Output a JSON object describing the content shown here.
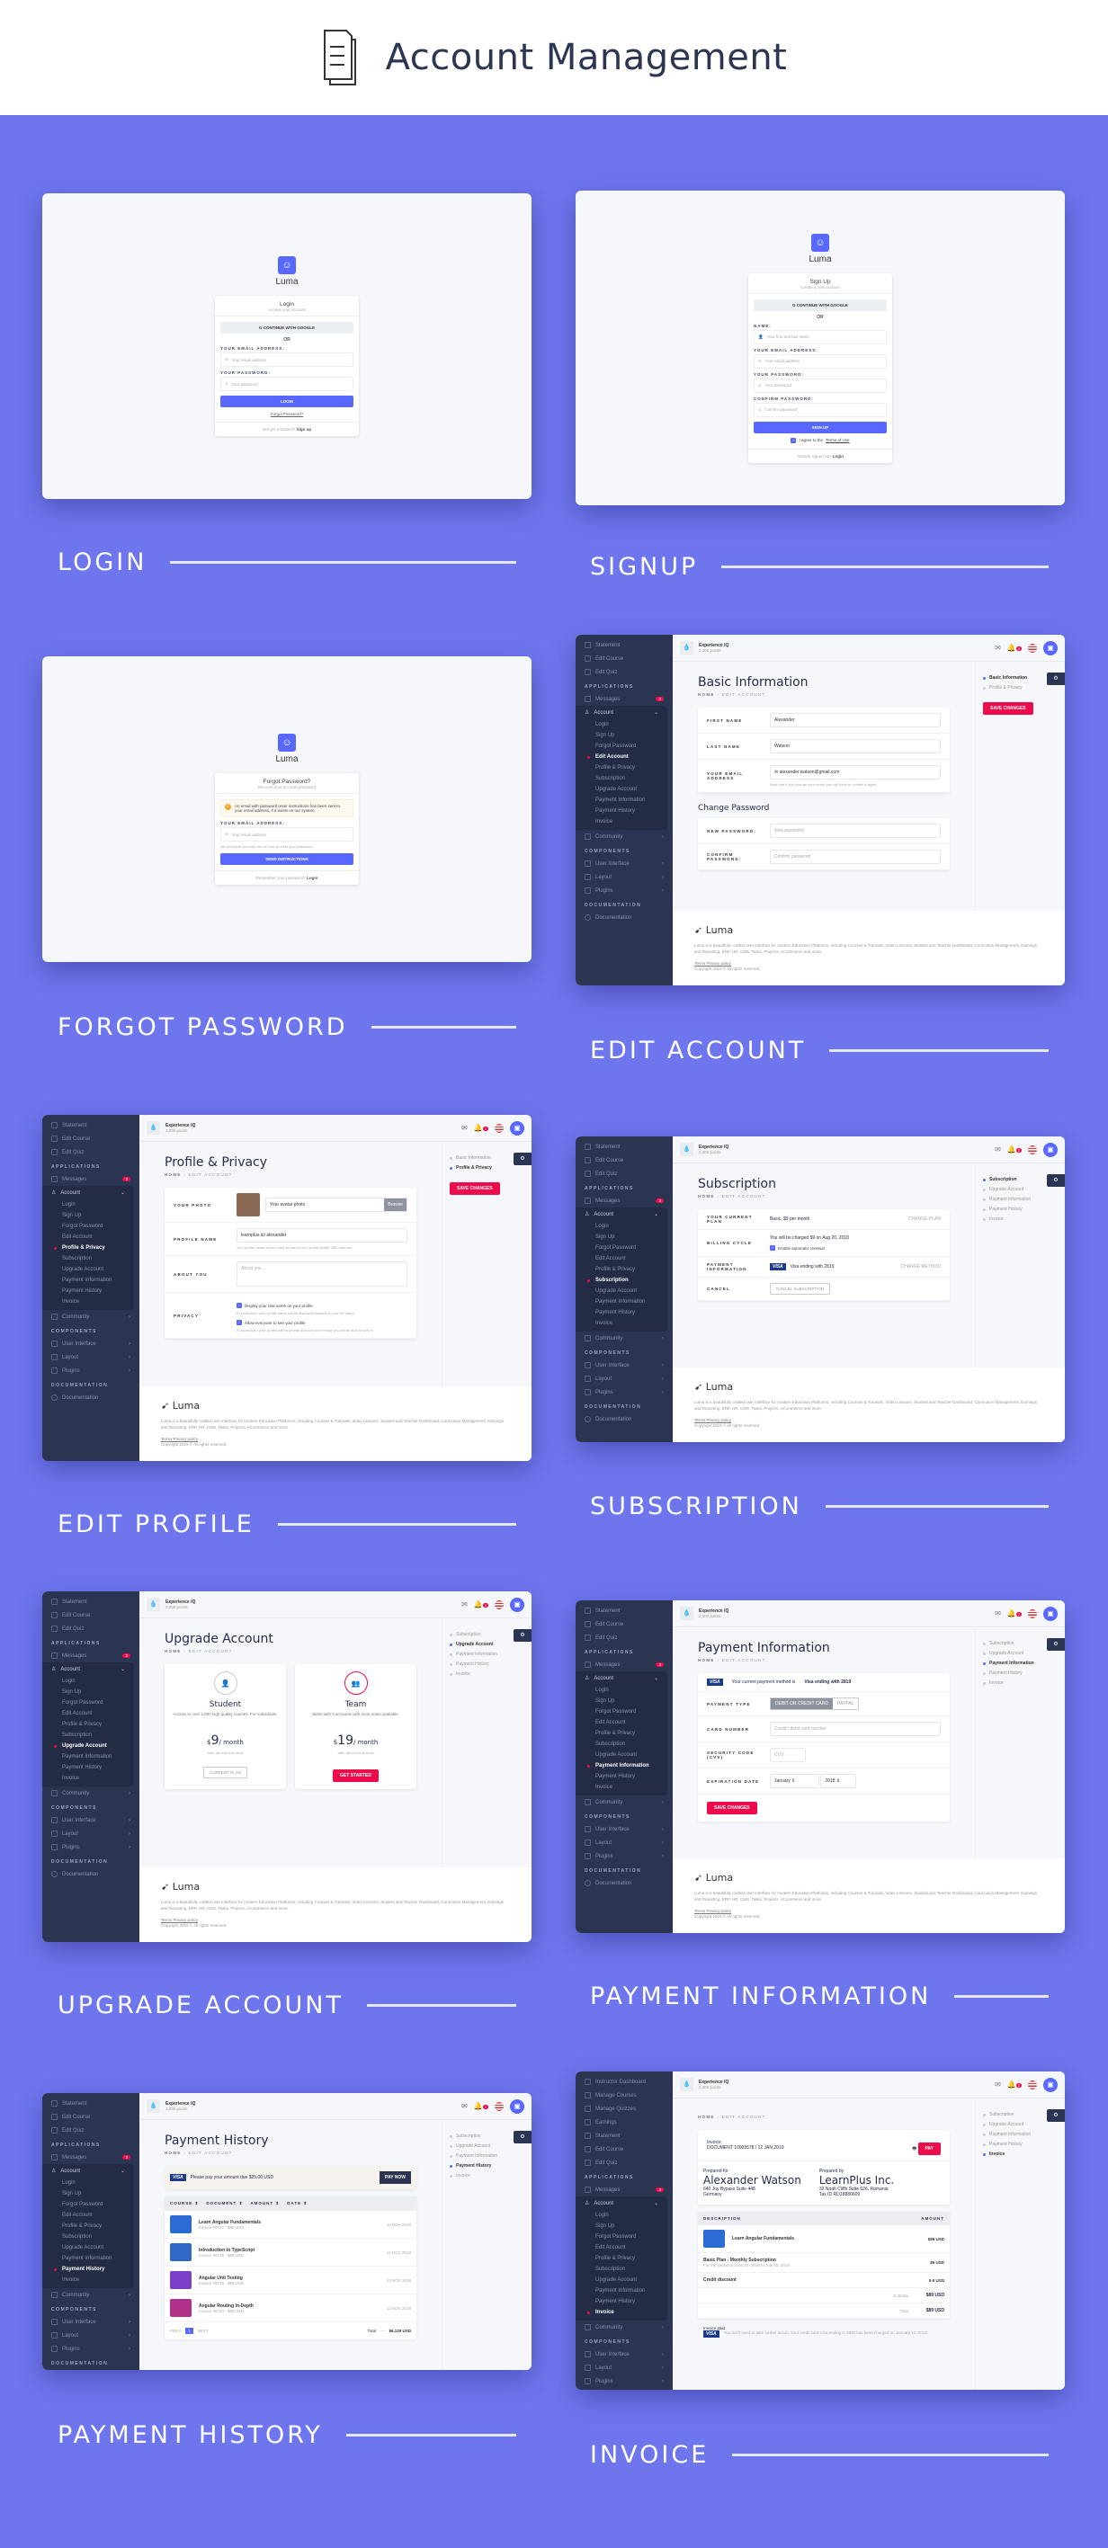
{
  "header": {
    "title": "Account Management",
    "icon": "document-icon"
  },
  "captions": [
    "LOGIN",
    "SIGNUP",
    "FORGOT PASSWORD",
    "EDIT ACCOUNT",
    "EDIT PROFILE",
    "SUBSCRIPTION",
    "UPGRADE ACCOUNT",
    "PAYMENT INFORMATION",
    "PAYMENT HISTORY",
    "INVOICE"
  ],
  "brand": "Luma",
  "login": {
    "title": "Login",
    "subtitle": "Access your account",
    "google": "CONTINUE WITH GOOGLE",
    "or": "OR",
    "email_label": "YOUR EMAIL ADDRESS:",
    "email_ph": "Your email address",
    "pass_label": "YOUR PASSWORD:",
    "pass_ph": "Your password",
    "submit": "LOGIN",
    "forgot": "Forgot Password?",
    "footer_text": "Not yet a student?",
    "footer_link": "Sign up"
  },
  "signup": {
    "title": "Sign Up",
    "subtitle": "Create a new account",
    "google": "CONTINUE WITH GOOGLE",
    "or": "OR",
    "name_label": "NAME:",
    "name_ph": "Your first and last name",
    "email_label": "YOUR EMAIL ADDRESS:",
    "email_ph": "Your email address",
    "pass_label": "YOUR PASSWORD:",
    "pass_ph": "Your password",
    "confirm_label": "CONFIRM PASSWORD:",
    "confirm_ph": "Confirm password",
    "submit": "SIGN UP",
    "agree": "I agree to the",
    "terms": "Terms of Use",
    "footer_text": "Already signed up?",
    "footer_link": "Login"
  },
  "forgot": {
    "title": "Forgot Password?",
    "subtitle": "Recover your account password",
    "alert": "An email with password reset instructions has been sent to your email address, if it exists on our system.",
    "email_label": "YOUR EMAIL ADDRESS:",
    "email_ph": "Your email address",
    "hint": "We will email you with info on how to reset your password.",
    "submit": "SEND INSTRUCTIONS",
    "footer_text": "Remember your password?",
    "footer_link": "Login"
  },
  "app": {
    "xp_title": "Experience IQ",
    "xp_points": "2,300 points",
    "notif_count": "2",
    "sidebar_top": [
      "Statement",
      "Edit Course",
      "Edit Quiz"
    ],
    "sidebar_top_invoice": [
      "Instructor Dashboard",
      "Manage Courses",
      "Manage Quizzes",
      "Earnings",
      "Statement",
      "Edit Course",
      "Edit Quiz"
    ],
    "applications": "APPLICATIONS",
    "messages": "Messages",
    "messages_badge": "3",
    "account": "Account",
    "account_items": [
      "Login",
      "Sign Up",
      "Forgot Password",
      "Edit Account",
      "Profile & Privacy",
      "Subscription",
      "Upgrade Account",
      "Payment Information",
      "Payment History",
      "Invoice"
    ],
    "community": "Community",
    "components": "COMPONENTS",
    "components_items": [
      "User Interface",
      "Layout",
      "Plugins"
    ],
    "documentation": "DOCUMENTATION",
    "doc_item": "Documentation",
    "breadcrumb_home": "HOME",
    "breadcrumb_current": "EDIT ACCOUNT",
    "save": "SAVE CHANGES",
    "rnav_edit": [
      "Basic Information",
      "Profile & Privacy"
    ],
    "rnav_billing": [
      "Subscription",
      "Upgrade Account",
      "Payment Information",
      "Payment History",
      "Invoice"
    ],
    "footer": {
      "brand": "Luma",
      "text": "Luma is a beautifully crafted user interface for modern Education Platforms, including Courses & Tutorials, Video Lessons, Student and Teacher Dashboard, Curriculum Management, Earnings and Reporting, ERP, HR, CMS, Tasks, Projects, eCommerce and more.",
      "terms": "Terms",
      "privacy": "Privacy policy",
      "copyright": "Copyright 2019 © All rights reserved."
    }
  },
  "edit_account": {
    "title": "Basic Information",
    "first_label": "FIRST NAME",
    "first": "Alexander",
    "last_label": "LAST NAME",
    "last": "Watson",
    "email_label": "YOUR EMAIL ADDRESS",
    "email": "alexander.watson@gmail.com",
    "email_hint": "Note that if you change your email, you will have to confirm it again.",
    "pw_title": "Change Password",
    "new_label": "NEW PASSWORD:",
    "new_ph": "New password",
    "confirm_label": "CONFIRM PASSWORD:",
    "confirm_ph": "Confirm password"
  },
  "profile": {
    "title": "Profile & Privacy",
    "photo_label": "YOUR PHOTO",
    "photo_ph": "Your avatar photo",
    "browse": "Browse",
    "name_label": "PROFILE NAME",
    "name_prefix": "learnplus.io/",
    "name": "alexander",
    "name_hint": "Your profile name will be used as part of your public profile URL address.",
    "about_label": "ABOUT YOU",
    "about_ph": "About you ...",
    "privacy_label": "PRIVACY",
    "opt1": "Display your real name on your profile",
    "opt1_hint": "If unchecked, your profile name will be displayed instead of your full name.",
    "opt2": "Allow everyone to see your profile",
    "opt2_hint": "If unchecked, your profile will be private and one one except you will be able to view it."
  },
  "subscription": {
    "title": "Subscription",
    "plan_label": "YOUR CURRENT PLAN",
    "plan": "Basic, $9 per month",
    "change_plan": "CHANGE PLAN",
    "cycle_label": "BILLING CYCLE",
    "cycle": "You will be charged $9 on Aug 20, 2018",
    "renew": "Enable automatic renewal",
    "pay_label": "PAYMENT INFORMATION",
    "card": "Visa ending with 2819",
    "change_method": "CHANGE METHOD",
    "cancel_label": "CANCEL",
    "cancel_btn": "CANCEL SUBSCRIPTION"
  },
  "upgrade": {
    "title": "Upgrade Account",
    "plans": [
      {
        "name": "Student",
        "desc": "Access to over 1.000 high quality courses. For individuals.",
        "price": "9",
        "per": "/ month",
        "after": "after the free trial ends",
        "btn": "CURRENT PLAN"
      },
      {
        "name": "Team",
        "desc": "Starts with 3 accounts with more seats available.",
        "price": "19",
        "per": "/ month",
        "after": "after the free trial ends",
        "btn": "GET STARTED"
      }
    ]
  },
  "payment_info": {
    "title": "Payment Information",
    "current": "Your current payment method is",
    "current_card": "Visa ending with 2819",
    "type_label": "PAYMENT TYPE",
    "type_card": "DEBIT OR CREDIT CARD",
    "type_paypal": "PAYPAL",
    "card_label": "CARD NUMBER",
    "card_ph": "Credit / debit card number",
    "cvv_label": "SECURITY CODE (CVV)",
    "cvv_ph": "CVV",
    "exp_label": "EXPIRATION DATE",
    "exp_month": "January",
    "exp_year": "2018"
  },
  "payment_history": {
    "title": "Payment History",
    "due": "Please pay your amount due $25.00 USD",
    "pay_now": "PAY NOW",
    "columns": [
      "COURSE",
      "DOCUMENT",
      "AMOUNT",
      "DATE"
    ],
    "rows": [
      {
        "course": "Learn Angular Fundamentals",
        "invoice": "Invoice #8737 - $89 USD",
        "date": "15 NOV 2018",
        "color": "#2b6bd6"
      },
      {
        "course": "Introduction to TypeScript",
        "invoice": "Invoice #8736 - $89 USD",
        "date": "14 NOV 2018",
        "color": "#3167c7"
      },
      {
        "course": "Angular Unit Testing",
        "invoice": "Invoice #8735 - $89 USD",
        "date": "13 NOV 2018",
        "color": "#7a3fc8"
      },
      {
        "course": "Angular Routing In-Depth",
        "invoice": "Invoice #8734 - $89 USD",
        "date": "12 NOV 2018",
        "color": "#b0308a"
      }
    ],
    "prev": "PREV",
    "page": "1",
    "next": "NEXT",
    "total_label": "Total",
    "total": "$6,129 USD"
  },
  "invoice": {
    "title": "Invoice",
    "doc": "DOCUMENT 10003578 / 12 JAN 2019",
    "pay": "PAY",
    "for_label": "Prepared for",
    "for_name": "Alexander Watson",
    "for_addr": "640 Joy Bypass Suite 448",
    "for_country": "Germany",
    "by_label": "Prepared by",
    "by_name": "LearnPlus Inc.",
    "by_addr": "32 Noah Cliffs Suite 626, Romania",
    "by_tax": "Tax ID RO18880609",
    "col_desc": "DESCRIPTION",
    "col_amount": "AMOUNT",
    "items": [
      {
        "desc": "Learn Angular Fundamentals",
        "sub": "",
        "amount": "$89 USD"
      },
      {
        "desc": "Basic Plan - Monthly Subscription",
        "sub": "For the period of June 20, 2018 to July 20, 2018",
        "amount": "$9 USD"
      },
      {
        "desc": "Credit discount",
        "sub": "",
        "amount": "$-5 USD"
      }
    ],
    "subtotal_label": "Subtotal",
    "subtotal": "$89 USD",
    "total_label": "Total",
    "total": "$89 USD",
    "paid_title": "Invoice paid",
    "paid_text": "You don't need to take further action. Your credit card Visa ending in 2819 has been charged on January 12, 2019."
  }
}
